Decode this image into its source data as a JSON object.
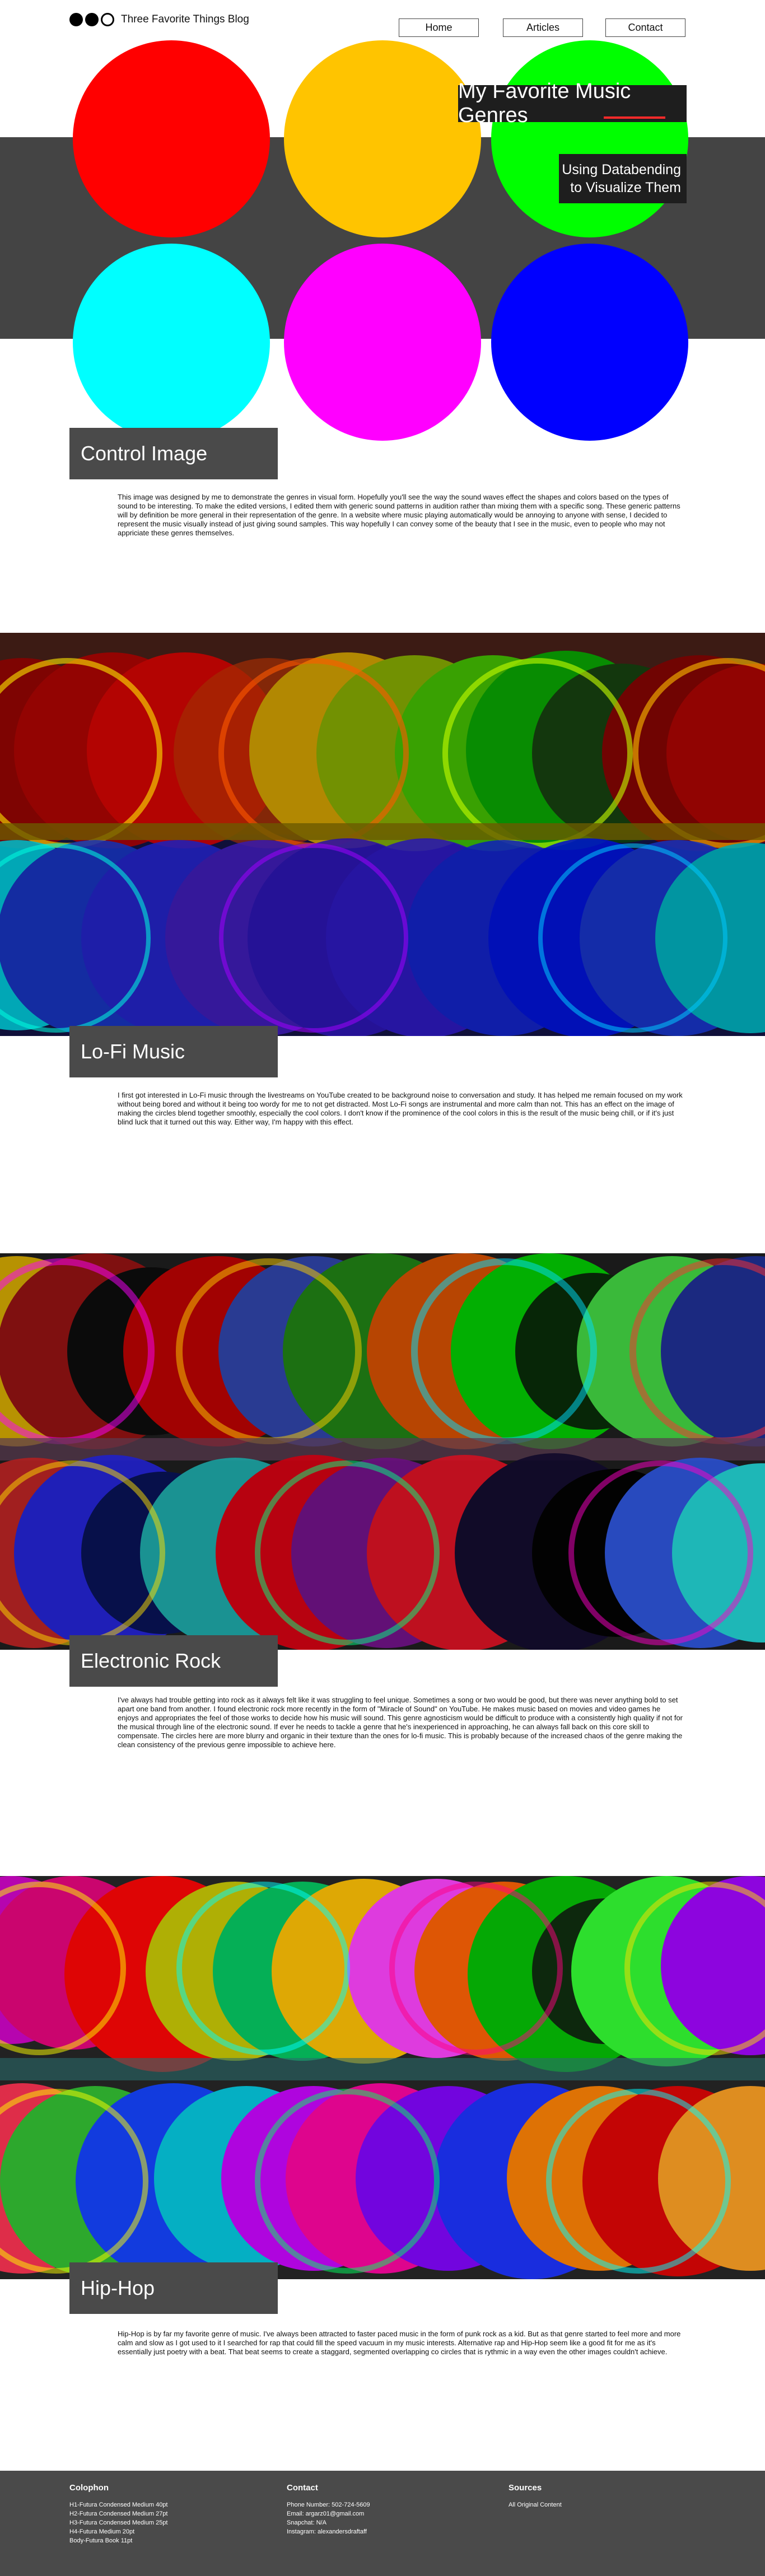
{
  "site": {
    "blog_name": "Three Favorite Things Blog",
    "nav": [
      "Home",
      "Articles",
      "Contact"
    ]
  },
  "hero": {
    "title": "My Favorite Music Genres",
    "subtitle_line1": "Using Databending",
    "subtitle_line2": "to Visualize Them",
    "circle_colors": [
      "#ff0000",
      "#ffc400",
      "#00ff00",
      "#00ffff",
      "#ff00ff",
      "#0000ff"
    ]
  },
  "sections": [
    {
      "label": "Control Image",
      "text": "This image was designed by me to demonstrate the genres in visual form. Hopefully you'll see the way the sound waves effect the shapes and colors based on the types of sound to be interesting. To make the edited versions, I edited them with generic sound patterns in audition rather than mixing them with a specific song. These generic patterns will by definition be more general in their representation of the genre. In a website where music playing automatically would be annoying to anyone with sense, I decided to represent the music visually instead of just giving sound samples. This way hopefully I can convey some of the beauty that I see in the music, even to people who may not appriciate these genres themselves."
    },
    {
      "label": "Lo-Fi Music",
      "text": "I first got interested in Lo-Fi music through the livestreams on YouTube created to be background noise to conversation and study. It has helped me remain focused on my work without being bored and without it being too wordy for me to not get distracted. Most Lo-Fi songs are instrumental and more calm than not. This has an effect on the image of making the circles blend together smoothly, especially the cool colors. I don't know if the prominence of the cool colors in this is the result of the music being chill, or if it's just blind luck that it turned out this way. Either way, I'm happy with this effect."
    },
    {
      "label": "Electronic Rock",
      "text": "I've always had trouble getting into rock as it always felt like it was struggling to feel unique. Sometimes a song or two would be good, but there was never anything bold to set apart one band from another. I found electronic rock more recently in the form of \"Miracle of Sound\" on YouTube. He makes music based on movies and video games he enjoys and appropriates the feel of those works to decide how his music will sound. This genre agnosticism would be difficult to produce with a consistently high quality if not for the musical through line of the electronic sound. If ever he needs to tackle a genre that he's inexperienced in approaching, he can always fall back on this core skill to compensate. The circles here are more blurry and organic in their texture than the ones for lo-fi music. This is probably because of the increased chaos of the genre making the clean consistency of the previous genre impossible to achieve here."
    },
    {
      "label": "Hip-Hop",
      "text": "Hip-Hop is by far my favorite genre of music. I've always been attracted to faster paced music in the form of punk rock as a kid. But as that genre started to feel more and more calm and slow as I got used to it I searched for rap that could fill the speed vacuum in my music interests. Alternative rap and Hip-Hop seem like a good fit for me as it's essentially just poetry with a beat. That beat seems to create a staggard, segmented overlapping co circles that is rythmic in a way even the other images couldn't achieve."
    }
  ],
  "footer": {
    "colophon_title": "Colophon",
    "colophon_lines": [
      "H1-Futura Condensed Medium 40pt",
      "H2-Futura Condensed Medium 27pt",
      "H3-Futura Condensed Medium 25pt",
      "H4-Futura Medium 20pt",
      "Body-Futura Book 11pt"
    ],
    "contact_title": "Contact",
    "contact_lines": [
      "Phone Number: 502-724-5609",
      "Email: argarz01@gmail.com",
      "Snapchat: N/A",
      "Instagram: alexandersdraftaff"
    ],
    "sources_title": "Sources",
    "sources_lines": [
      "All Original Content"
    ]
  }
}
